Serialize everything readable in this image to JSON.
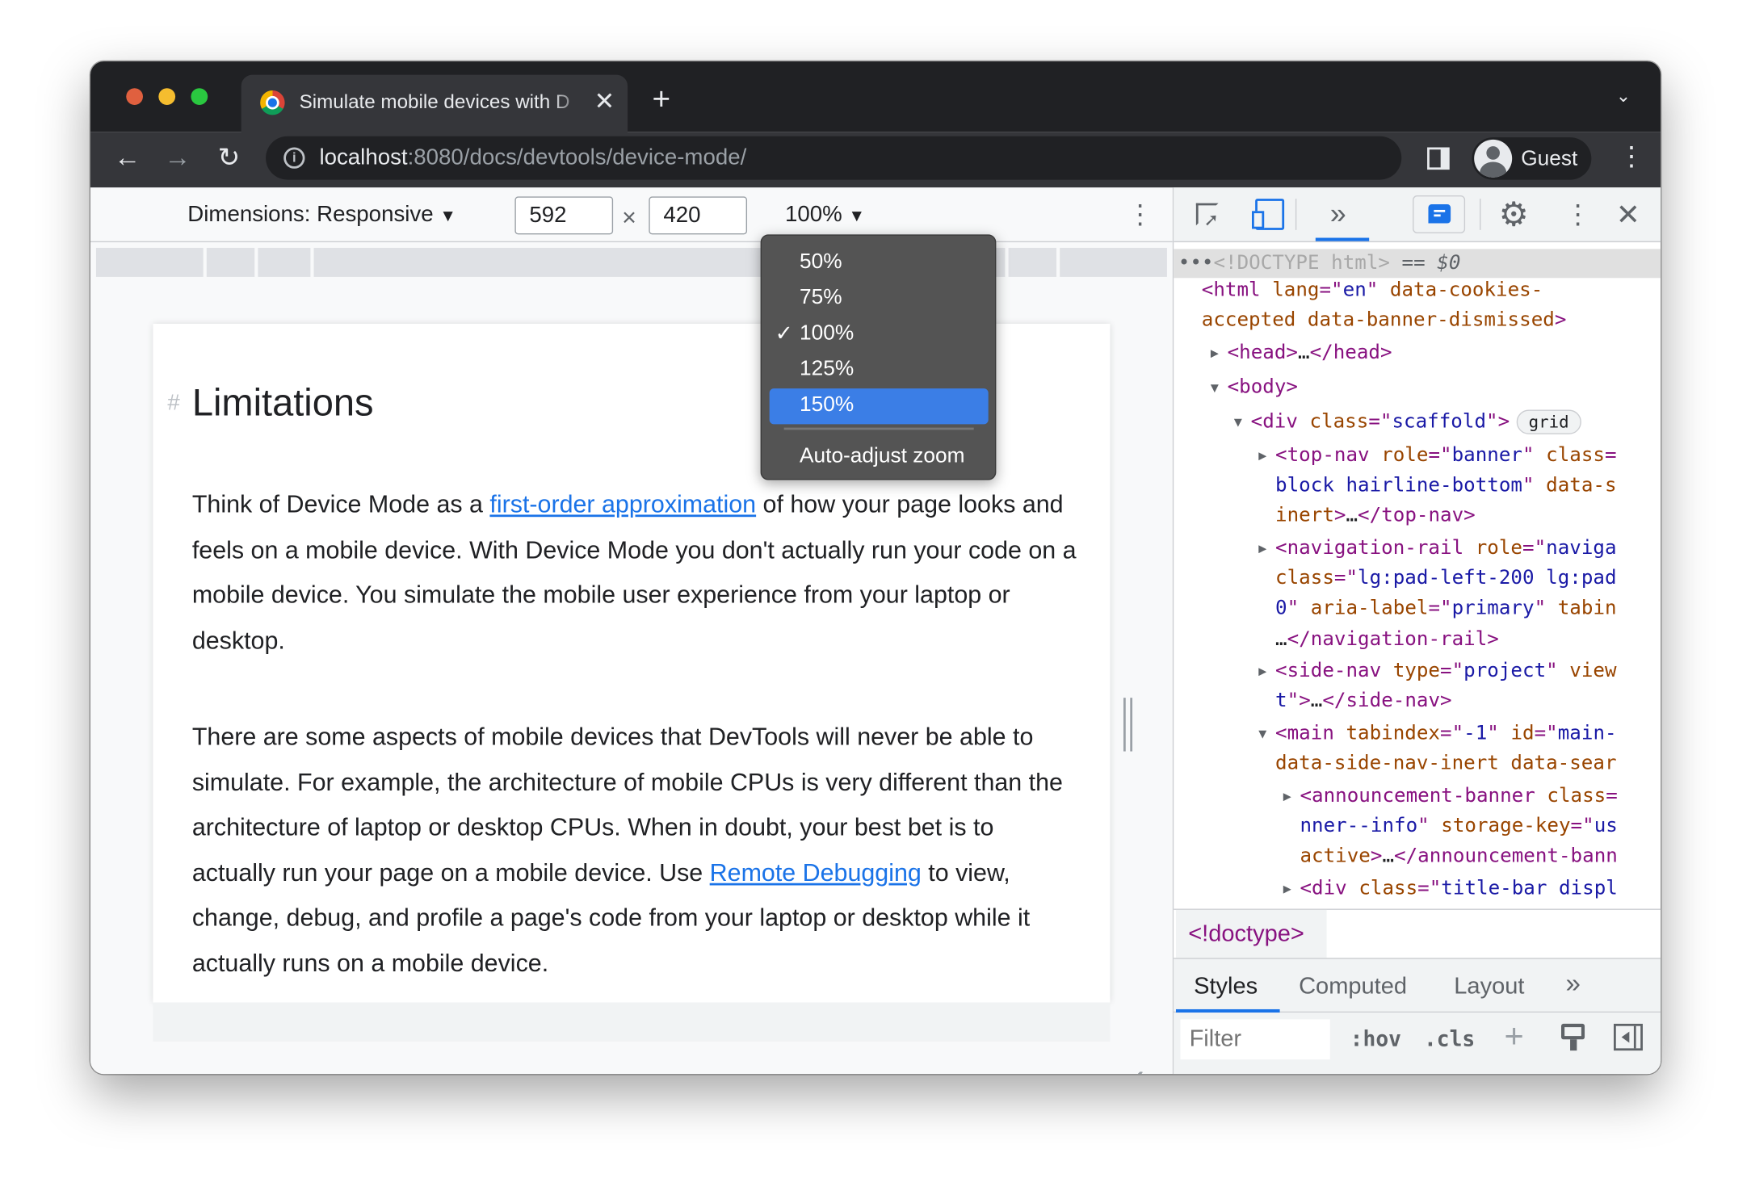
{
  "browser": {
    "tab_title": "Simulate mobile devices with D",
    "url_host": "localhost",
    "url_path": ":8080/docs/devtools/device-mode/",
    "profile": "Guest",
    "traffic_lights": [
      "#e0603f",
      "#f5bd2f",
      "#2ac840"
    ]
  },
  "device_toolbar": {
    "dimensions_label": "Dimensions: Responsive",
    "width": "592",
    "times": "×",
    "height": "420",
    "zoom": "100%"
  },
  "zoom_menu": {
    "items": [
      {
        "label": "50%",
        "checked": false,
        "highlighted": false
      },
      {
        "label": "75%",
        "checked": false,
        "highlighted": false
      },
      {
        "label": "100%",
        "checked": true,
        "highlighted": false
      },
      {
        "label": "125%",
        "checked": false,
        "highlighted": false
      },
      {
        "label": "150%",
        "checked": false,
        "highlighted": true
      }
    ],
    "checkmark": "✓",
    "auto_adjust": "Auto-adjust zoom",
    "highlight_color": "#3b7ee6"
  },
  "page": {
    "anchor": "#",
    "heading": "Limitations",
    "p1_before": "Think of Device Mode as a ",
    "p1_link": "first-order approximation",
    "p1_after": " of how your page looks and feels on a mobile device. With Device Mode you don't actually run your code on a mobile device. You simulate the mobile user experience from your laptop or desktop.",
    "p2_before": "There are some aspects of mobile devices that DevTools will never be able to simulate. For example, the architecture of mobile CPUs is very different than the architecture of laptop or desktop CPUs. When in doubt, your best bet is to actually run your page on a mobile device. Use ",
    "p2_link": "Remote Debugging",
    "p2_after": " to view, change, debug, and profile a page's code from your laptop or desktop while it actually runs on a mobile device."
  },
  "devtools": {
    "more_tabs": "»",
    "selected_line": {
      "dots": "•••",
      "doctype": "<!DOCTYPE html>",
      "eq": " == ",
      "ref": "$0"
    },
    "tree": [
      {
        "indent": 0,
        "tri": "",
        "segs": [
          [
            "tag",
            "<html "
          ],
          [
            "an",
            "lang"
          ],
          [
            "tag",
            "=\""
          ],
          [
            "av",
            "en"
          ],
          [
            "tag",
            "\" "
          ],
          [
            "an",
            "data-cookies-"
          ]
        ]
      },
      {
        "indent": 0,
        "tri": "",
        "segs": [
          [
            "an",
            "accepted data-banner-dismissed"
          ],
          [
            "tag",
            ">"
          ]
        ]
      },
      {
        "indent": 1,
        "tri": "▶",
        "segs": [
          [
            "tag",
            "<head>"
          ],
          [
            "tx",
            "…"
          ],
          [
            "tag",
            "</head>"
          ]
        ]
      },
      {
        "indent": 1,
        "tri": "▼",
        "segs": [
          [
            "tag",
            "<body>"
          ]
        ]
      },
      {
        "indent": 2,
        "tri": "▼",
        "segs": [
          [
            "tag",
            "<div "
          ],
          [
            "an",
            "class"
          ],
          [
            "tag",
            "=\""
          ],
          [
            "av",
            "scaffold"
          ],
          [
            "tag",
            "\">"
          ]
        ],
        "badge": "grid"
      },
      {
        "indent": 3,
        "tri": "▶",
        "segs": [
          [
            "tag",
            "<top-nav "
          ],
          [
            "an",
            "role"
          ],
          [
            "tag",
            "=\""
          ],
          [
            "av",
            "banner"
          ],
          [
            "tag",
            "\" "
          ],
          [
            "an",
            "class"
          ],
          [
            "tag",
            "="
          ]
        ]
      },
      {
        "indent": 3,
        "tri": "",
        "segs": [
          [
            "av",
            "block hairline-bottom"
          ],
          [
            "tag",
            "\" "
          ],
          [
            "an",
            "data-s"
          ]
        ]
      },
      {
        "indent": 3,
        "tri": "",
        "segs": [
          [
            "an",
            "inert"
          ],
          [
            "tag",
            ">"
          ],
          [
            "tx",
            "…"
          ],
          [
            "tag",
            "</top-nav>"
          ]
        ]
      },
      {
        "indent": 3,
        "tri": "▶",
        "segs": [
          [
            "tag",
            "<navigation-rail "
          ],
          [
            "an",
            "role"
          ],
          [
            "tag",
            "=\""
          ],
          [
            "av",
            "naviga"
          ]
        ]
      },
      {
        "indent": 3,
        "tri": "",
        "segs": [
          [
            "an",
            "class"
          ],
          [
            "tag",
            "=\""
          ],
          [
            "av",
            "lg:pad-left-200 lg:pad"
          ]
        ]
      },
      {
        "indent": 3,
        "tri": "",
        "segs": [
          [
            "av",
            "0"
          ],
          [
            "tag",
            "\" "
          ],
          [
            "an",
            "aria-label"
          ],
          [
            "tag",
            "=\""
          ],
          [
            "av",
            "primary"
          ],
          [
            "tag",
            "\" "
          ],
          [
            "an",
            "tabin"
          ]
        ]
      },
      {
        "indent": 3,
        "tri": "",
        "segs": [
          [
            "tx",
            "…"
          ],
          [
            "tag",
            "</navigation-rail>"
          ]
        ]
      },
      {
        "indent": 3,
        "tri": "▶",
        "segs": [
          [
            "tag",
            "<side-nav "
          ],
          [
            "an",
            "type"
          ],
          [
            "tag",
            "=\""
          ],
          [
            "av",
            "project"
          ],
          [
            "tag",
            "\" "
          ],
          [
            "an",
            "view"
          ]
        ]
      },
      {
        "indent": 3,
        "tri": "",
        "segs": [
          [
            "av",
            "t"
          ],
          [
            "tag",
            "\">"
          ],
          [
            "tx",
            "…"
          ],
          [
            "tag",
            "</side-nav>"
          ]
        ]
      },
      {
        "indent": 3,
        "tri": "▼",
        "segs": [
          [
            "tag",
            "<main "
          ],
          [
            "an",
            "tabindex"
          ],
          [
            "tag",
            "=\""
          ],
          [
            "av",
            "-1"
          ],
          [
            "tag",
            "\" "
          ],
          [
            "an",
            "id"
          ],
          [
            "tag",
            "=\""
          ],
          [
            "av",
            "main-"
          ]
        ]
      },
      {
        "indent": 3,
        "tri": "",
        "segs": [
          [
            "an",
            "data-side-nav-inert data-sear"
          ]
        ]
      },
      {
        "indent": 4,
        "tri": "▶",
        "segs": [
          [
            "tag",
            "<announcement-banner "
          ],
          [
            "an",
            "class"
          ],
          [
            "tag",
            "="
          ]
        ]
      },
      {
        "indent": 4,
        "tri": "",
        "segs": [
          [
            "av",
            "nner--info"
          ],
          [
            "tag",
            "\" "
          ],
          [
            "an",
            "storage-key"
          ],
          [
            "tag",
            "=\""
          ],
          [
            "av",
            "us"
          ]
        ]
      },
      {
        "indent": 4,
        "tri": "",
        "segs": [
          [
            "an",
            "active"
          ],
          [
            "tag",
            ">"
          ],
          [
            "tx",
            "…"
          ],
          [
            "tag",
            "</announcement-bann"
          ]
        ]
      },
      {
        "indent": 4,
        "tri": "▶",
        "segs": [
          [
            "tag",
            "<div "
          ],
          [
            "an",
            "class"
          ],
          [
            "tag",
            "=\""
          ],
          [
            "av",
            "title-bar displ"
          ]
        ]
      }
    ],
    "breadcrumb": "<!doctype>",
    "panel_tabs": [
      "Styles",
      "Computed",
      "Layout"
    ],
    "panel_more": "»",
    "filter_placeholder": "Filter",
    "hov": ":hov",
    "cls": ".cls",
    "plus": "+"
  }
}
